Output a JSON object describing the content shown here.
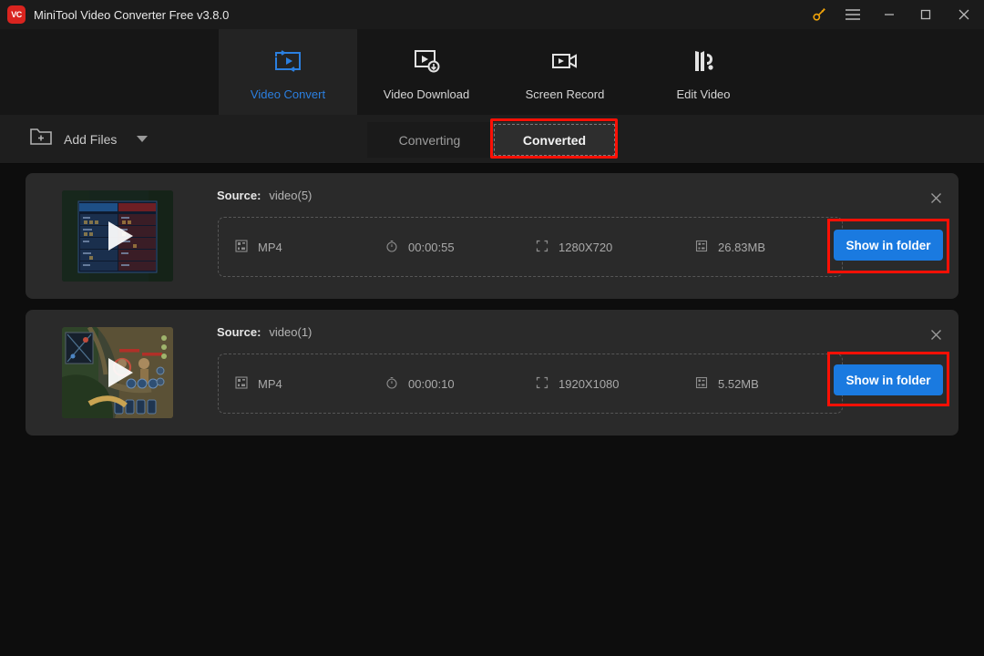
{
  "window": {
    "title": "MiniTool Video Converter Free v3.8.0",
    "logo_text": "VC",
    "logo_color": "#d9241f",
    "controls": [
      {
        "name": "key-icon",
        "label": "key",
        "color": "#f0a30a"
      },
      {
        "name": "menu-icon",
        "label": "menu",
        "color": "#b9b9b9"
      },
      {
        "name": "minimize-icon",
        "label": "minimize",
        "color": "#b9b9b9"
      },
      {
        "name": "maximize-icon",
        "label": "maximize",
        "color": "#b9b9b9"
      },
      {
        "name": "close-icon",
        "label": "close",
        "color": "#b9b9b9"
      }
    ]
  },
  "nav": {
    "accent_color": "#2b7fe0",
    "items": [
      {
        "label": "Video Convert",
        "icon": "convert-icon",
        "active": true
      },
      {
        "label": "Video Download",
        "icon": "download-icon",
        "active": false
      },
      {
        "label": "Screen Record",
        "icon": "record-icon",
        "active": false
      },
      {
        "label": "Edit Video",
        "icon": "edit-icon",
        "active": false
      }
    ]
  },
  "toolbar": {
    "add_files_label": "Add Files",
    "add_files_icon": "folder-plus-icon",
    "dropdown_icon": "chevron-down-icon",
    "tabs": [
      {
        "label": "Converting",
        "active": false,
        "highlighted": false
      },
      {
        "label": "Converted",
        "active": true,
        "highlighted": true
      }
    ],
    "highlight_color": "#fc1005"
  },
  "files": [
    {
      "source_label": "Source:",
      "source_name": "video(5)",
      "format": "MP4",
      "duration": "00:00:55",
      "resolution": "1280X720",
      "size": "26.83MB",
      "action_label": "Show in folder",
      "highlighted": true,
      "thumbnail": "game-scoreboard-thumbnail"
    },
    {
      "source_label": "Source:",
      "source_name": "video(1)",
      "format": "MP4",
      "duration": "00:00:10",
      "resolution": "1920X1080",
      "size": "5.52MB",
      "action_label": "Show in folder",
      "highlighted": true,
      "thumbnail": "game-map-thumbnail"
    }
  ],
  "icons": {
    "format": "film-format-icon",
    "duration": "stopwatch-icon",
    "resolution": "expand-arrows-icon",
    "size": "file-size-icon",
    "remove": "close-icon",
    "play": "play-icon"
  },
  "colors": {
    "page_bg": "#0d0d0d",
    "card_bg": "#2a2a2a",
    "accent_blue": "#1a7ae0",
    "highlight_red": "#fc1005"
  }
}
